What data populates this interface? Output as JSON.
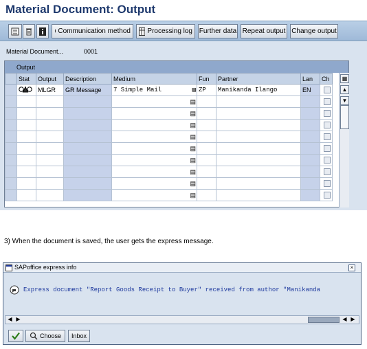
{
  "header": {
    "title": "Material Document: Output"
  },
  "toolbar": {
    "icons": [
      "details-icon",
      "delete-icon",
      "info-icon"
    ],
    "communication_label": "Communication method",
    "processing_log_label": "Processing log",
    "further_data_label": "Further data",
    "repeat_output_label": "Repeat output",
    "change_output_label": "Change output"
  },
  "doc": {
    "label": "Material Document...",
    "value": "0001"
  },
  "grid": {
    "title": "Output",
    "columns": [
      "Stat",
      "Output",
      "Description",
      "Medium",
      "Fun",
      "Partner",
      "Lan",
      "Ch"
    ],
    "rows": [
      {
        "stat": "",
        "output": "MLGR",
        "description": "GR Message",
        "medium": "7 Simple Mail",
        "fun": "ZP",
        "partner": "Manikanda Ilango",
        "lan": "EN"
      }
    ]
  },
  "caption": "3) When the document is saved, the user gets the express message.",
  "popup": {
    "title": "SAPoffice express info",
    "message": "Express document \"Report Goods Receipt to Buyer\" received from author \"Manikanda",
    "choose_label": "Choose",
    "inbox_label": "Inbox"
  },
  "colors": {
    "accent": "#1f3a6e",
    "grid_header": "#8fa8cc",
    "message": "#1f3a9e"
  }
}
